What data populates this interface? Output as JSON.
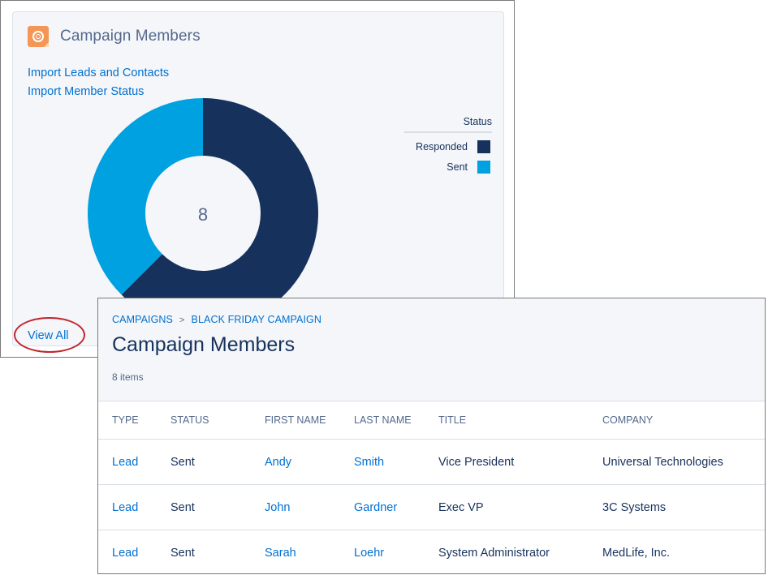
{
  "card": {
    "icon": "campaign-target-icon",
    "title": "Campaign Members",
    "links": [
      "Import Leads and Contacts",
      "Import Member Status"
    ],
    "view_all": "View All",
    "accent_color": "#f49756"
  },
  "chart_data": {
    "type": "pie",
    "variant": "donut",
    "center_label": "8",
    "total": 8,
    "legend_title": "Status",
    "legend_position": "right",
    "slices": [
      {
        "name": "Responded",
        "value": 5,
        "color": "#16325c"
      },
      {
        "name": "Sent",
        "value": 3,
        "color": "#00a1e0"
      }
    ]
  },
  "panel": {
    "breadcrumb": [
      "CAMPAIGNS",
      "BLACK FRIDAY CAMPAIGN"
    ],
    "breadcrumb_separator": ">",
    "title": "Campaign Members",
    "item_count": "8 items",
    "columns": [
      "TYPE",
      "STATUS",
      "FIRST NAME",
      "LAST NAME",
      "TITLE",
      "COMPANY"
    ],
    "rows": [
      {
        "type": "Lead",
        "status": "Sent",
        "first_name": "Andy",
        "last_name": "Smith",
        "title": "Vice President",
        "company": "Universal Technologies"
      },
      {
        "type": "Lead",
        "status": "Sent",
        "first_name": "John",
        "last_name": "Gardner",
        "title": "Exec VP",
        "company": "3C Systems"
      },
      {
        "type": "Lead",
        "status": "Sent",
        "first_name": "Sarah",
        "last_name": "Loehr",
        "title": "System Administrator",
        "company": "MedLife, Inc."
      }
    ]
  }
}
